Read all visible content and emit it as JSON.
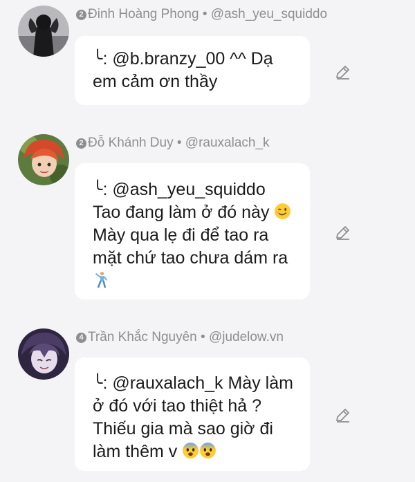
{
  "comments": [
    {
      "level": "2",
      "author": "Đinh Hoàng Phong",
      "separator": "•",
      "handle": "@ash_yeu_squiddo",
      "reply_mark": "╰",
      "text": ": @b.branzy_00 ^^ Dạ em cảm ơn thầy",
      "avatar_icon": "dark-figure-avatar"
    },
    {
      "level": "2",
      "author": "Đỗ Khánh Duy",
      "separator": "•",
      "handle": "@rauxalach_k",
      "reply_mark": "╰",
      "text_a": ": @ash_yeu_squiddo Tao đang làm ở đó này",
      "text_b": "Mày qua lẹ đi để tao ra mặt chứ tao chưa dám ra",
      "emoji_1": "winking-face-icon",
      "emoji_2": "dancing-man-icon",
      "avatar_icon": "red-hair-anime-avatar"
    },
    {
      "level": "4",
      "author": "Trần Khắc Nguyên",
      "separator": "•",
      "handle": "@judelow.vn",
      "reply_mark": "╰",
      "text": ": @rauxalach_k Mày làm ở đó với tao thiệt hả ? Thiếu gia mà sao giờ đi làm thêm v",
      "emoji": "fearful-face-icon",
      "avatar_icon": "purple-anime-avatar"
    }
  ],
  "colors": {
    "background": "#f4f4f6",
    "bubble": "#ffffff",
    "meta_text": "#8e8e92",
    "body_text": "#1b1b1b",
    "edit_icon": "#8e8e92"
  }
}
